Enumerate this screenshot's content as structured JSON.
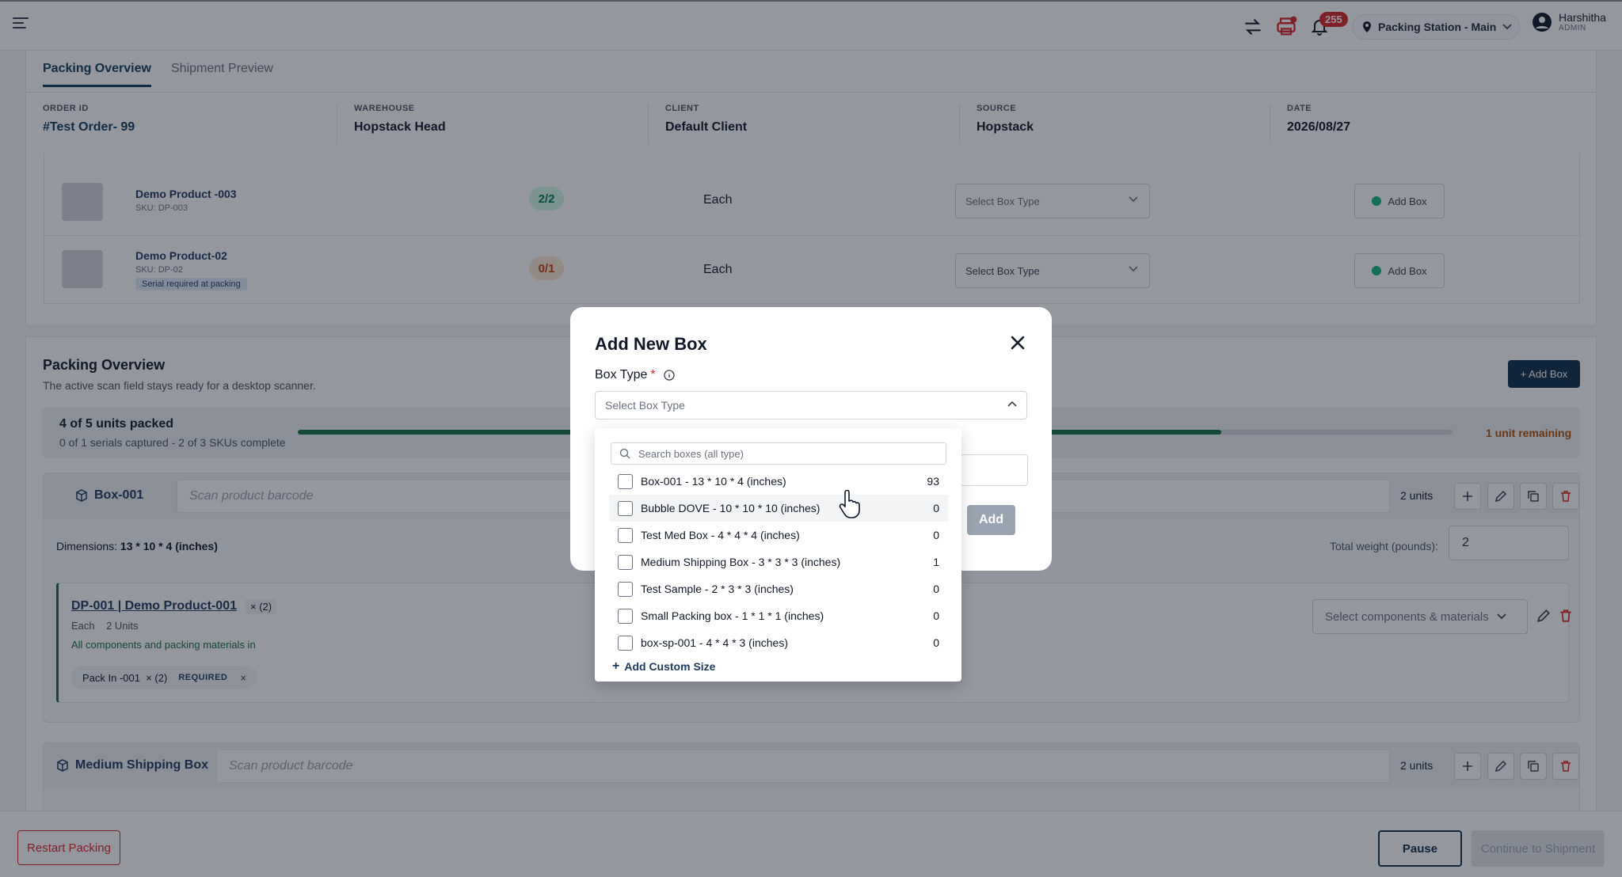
{
  "header": {
    "notif_count": "255",
    "station": "Packing Station - Main",
    "user_name": "Harshitha",
    "user_role": "ADMIN"
  },
  "tabs": [
    "Packing Overview",
    "Shipment Preview"
  ],
  "order_meta": [
    {
      "label": "ORDER ID",
      "value": "#Test Order- 99"
    },
    {
      "label": "WAREHOUSE",
      "value": "Hopstack Head"
    },
    {
      "label": "CLIENT",
      "value": "Default Client"
    },
    {
      "label": "SOURCE",
      "value": "Hopstack"
    },
    {
      "label": "DATE",
      "value": "2026/08/27"
    }
  ],
  "products": [
    {
      "name": "Demo Product -003",
      "sku": "SKU: DP-003",
      "qty": "2/2",
      "uom": "Each",
      "box_placeholder": "Select Box Type",
      "add_label": "Add Box",
      "serial_tag": ""
    },
    {
      "name": "Demo Product-02",
      "sku": "SKU: DP-02",
      "qty": "0/1",
      "uom": "Each",
      "box_placeholder": "Select Box Type",
      "add_label": "Add Box",
      "serial_tag": "Serial required at packing"
    }
  ],
  "packing": {
    "title": "Packing Overview",
    "subtitle": "The active scan field stays ready for a desktop scanner.",
    "add_box": "+ Add Box",
    "units_packed": "4 of 5 units packed",
    "progress_sub": "0 of 1 serials captured - 2 of 3 SKUs complete",
    "progress_fraction": 0.8,
    "remaining": "1 unit remaining",
    "boxes": [
      {
        "name": "Box-001",
        "scan_placeholder": "Scan product barcode",
        "units": "2 units",
        "dims_label": "Dimensions:",
        "dims_value": "13 * 10 * 4 (inches)",
        "weight_label": "Total weight (pounds):",
        "weight_value": "2",
        "item": {
          "name": "DP-001 | Demo Product-001",
          "badge": "× (2)",
          "sub": "Each    2 Units",
          "status": "All components and packing materials in",
          "pack_in": "Pack In -001  × (2)",
          "required": "REQUIRED",
          "remove": "×",
          "components_placeholder": "Select components & materials"
        }
      },
      {
        "name": "Medium Shipping Box",
        "scan_placeholder": "Scan product barcode",
        "units": "2 units"
      }
    ]
  },
  "footer": {
    "restart": "Restart Packing",
    "pause": "Pause",
    "continue": "Continue to Shipment"
  },
  "modal": {
    "title": "Add New Box",
    "box_type_label": "Box Type",
    "required_mark": "*",
    "select_placeholder": "Select Box Type",
    "add_button": "Add",
    "search_placeholder": "Search boxes (all type)",
    "options": [
      {
        "label": "Box-001 - 13 * 10 * 4 (inches)",
        "count": "93"
      },
      {
        "label": "Bubble DOVE - 10 * 10 * 10 (inches)",
        "count": "0"
      },
      {
        "label": "Test Med Box - 4 * 4 * 4 (inches)",
        "count": "0"
      },
      {
        "label": "Medium Shipping Box - 3 * 3 * 3 (inches)",
        "count": "1"
      },
      {
        "label": "Test Sample - 2 * 3 * 3 (inches)",
        "count": "0"
      },
      {
        "label": "Small Packing box - 1 * 1 * 1 (inches)",
        "count": "0"
      },
      {
        "label": "box-sp-001 - 4 * 4 * 3 (inches)",
        "count": "0"
      }
    ],
    "add_custom": "Add Custom Size"
  }
}
